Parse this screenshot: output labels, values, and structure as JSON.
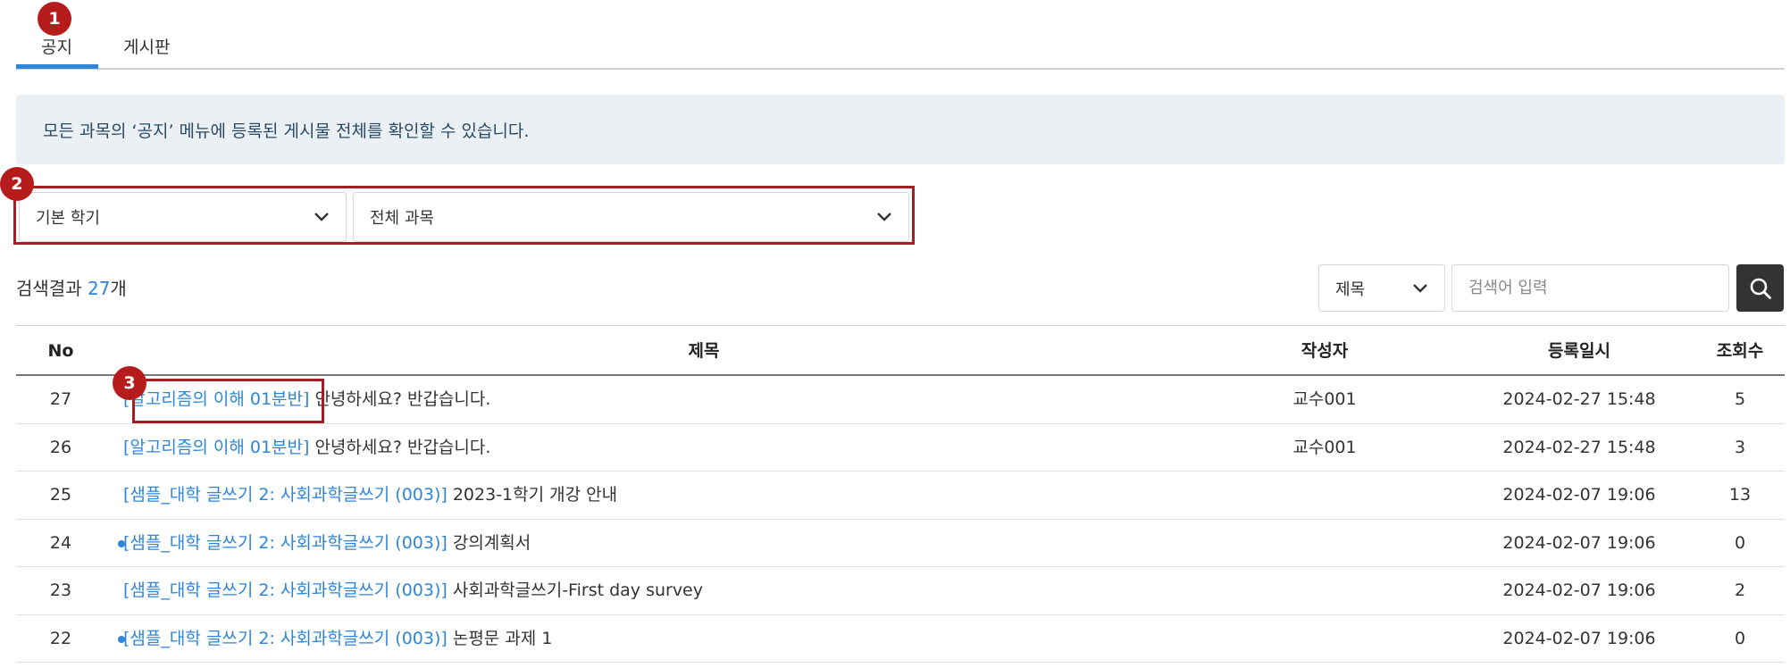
{
  "tabs": [
    {
      "label": "공지"
    },
    {
      "label": "게시판"
    }
  ],
  "badges": [
    "1",
    "2",
    "3"
  ],
  "info_banner": "모든 과목의 ‘공지’ 메뉴에 등록된 게시물 전체를 확인할 수 있습니다.",
  "filters": {
    "semester": "기본 학기",
    "course": "전체 과목"
  },
  "results": {
    "prefix": "검색결과 ",
    "count": "27",
    "suffix": "개"
  },
  "search": {
    "field": "제목",
    "placeholder": "검색어 입력"
  },
  "table": {
    "headers": {
      "no": "No",
      "title": "제목",
      "author": "작성자",
      "date": "등록일시",
      "views": "조회수"
    },
    "rows": [
      {
        "no": "27",
        "course": "[알고리즘의 이해 01분반]",
        "title": " 안녕하세요? 반갑습니다.",
        "author": "교수001",
        "date": "2024-02-27 15:48",
        "views": "5",
        "unread": false
      },
      {
        "no": "26",
        "course": "[알고리즘의 이해 01분반]",
        "title": " 안녕하세요? 반갑습니다.",
        "author": "교수001",
        "date": "2024-02-27 15:48",
        "views": "3",
        "unread": false
      },
      {
        "no": "25",
        "course": "[샘플_대학 글쓰기 2: 사회과학글쓰기 (003)]",
        "title": " 2023-1학기 개강 안내",
        "author": "",
        "date": "2024-02-07 19:06",
        "views": "13",
        "unread": false
      },
      {
        "no": "24",
        "course": "[샘플_대학 글쓰기 2: 사회과학글쓰기 (003)]",
        "title": " 강의계획서",
        "author": "",
        "date": "2024-02-07 19:06",
        "views": "0",
        "unread": true
      },
      {
        "no": "23",
        "course": "[샘플_대학 글쓰기 2: 사회과학글쓰기 (003)]",
        "title": " 사회과학글쓰기-First day survey",
        "author": "",
        "date": "2024-02-07 19:06",
        "views": "2",
        "unread": false
      },
      {
        "no": "22",
        "course": "[샘플_대학 글쓰기 2: 사회과학글쓰기 (003)]",
        "title": " 논평문 과제 1",
        "author": "",
        "date": "2024-02-07 19:06",
        "views": "0",
        "unread": true
      }
    ]
  },
  "colors": {
    "accent": "#2f86d8",
    "badge": "#b71c1c",
    "highlight": "#a51c24",
    "banner_bg": "#eaf0f4"
  },
  "icons": {
    "search": "search-icon",
    "dropdown": "chevron-down-icon",
    "unread": "unread-dot-icon"
  }
}
